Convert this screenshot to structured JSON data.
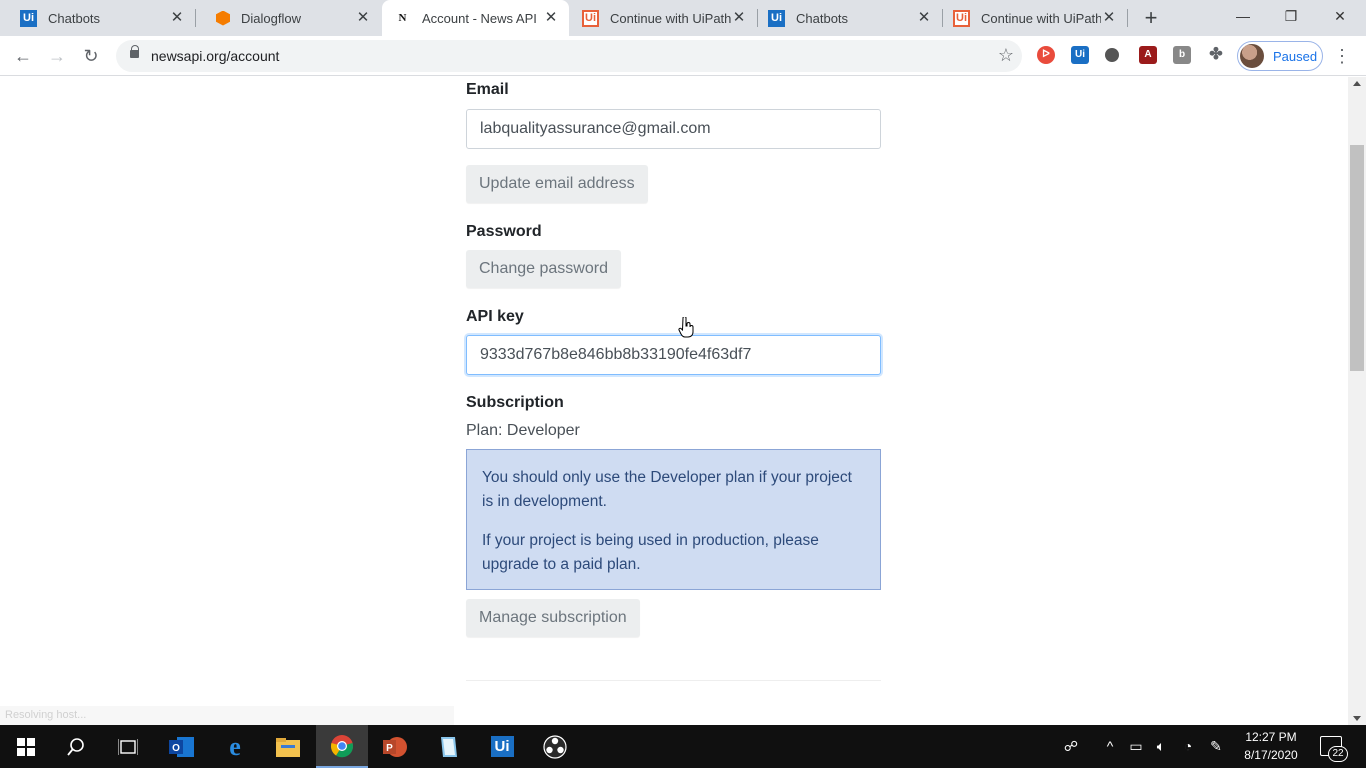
{
  "browser": {
    "tabs": [
      {
        "title": "Chatbots",
        "favicon": "uipath-icon",
        "active": false
      },
      {
        "title": "Dialogflow",
        "favicon": "dialogflow-icon",
        "active": false
      },
      {
        "title": "Account - News API",
        "favicon": "newsapi-icon",
        "active": true
      },
      {
        "title": "Continue with UiPath",
        "favicon": "uipath-orange-icon",
        "active": false
      },
      {
        "title": "Chatbots",
        "favicon": "uipath-icon",
        "active": false
      },
      {
        "title": "Continue with UiPath",
        "favicon": "uipath-orange-icon",
        "active": false
      }
    ],
    "url": "newsapi.org/account",
    "profile_label": "Paused",
    "accent_color": "#1a73e8"
  },
  "account": {
    "email_label": "Email",
    "email_value": "labqualityassurance@gmail.com",
    "update_email_button": "Update email address",
    "password_label": "Password",
    "change_password_button": "Change password",
    "api_key_label": "API key",
    "api_key_value": "9333d767b8e846bb8b33190fe4f63df7",
    "subscription_label": "Subscription",
    "plan_text": "Plan: Developer",
    "alert_line1": "You should only use the Developer plan if your project is in development.",
    "alert_line2": "If your project is being used in production, please upgrade to a paid plan.",
    "manage_subscription_button": "Manage subscription",
    "status_hint": "Resolving host..."
  },
  "taskbar": {
    "time": "12:27 PM",
    "date": "8/17/2020",
    "notification_count": "22"
  }
}
